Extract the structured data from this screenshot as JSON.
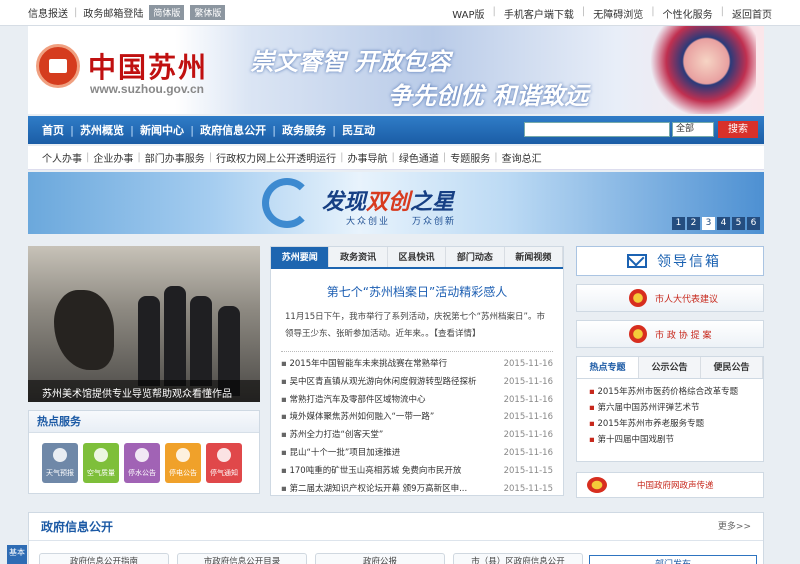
{
  "topbar": {
    "left": [
      "信息报送",
      "政务邮箱登陆"
    ],
    "lang": [
      "简体版",
      "繁体版"
    ],
    "right": [
      "WAP版",
      "手机客户端下载",
      "无障碍浏览",
      "个性化服务",
      "返回首页"
    ]
  },
  "header": {
    "site_name": "中国苏州",
    "url": "www.suzhou.gov.cn",
    "slogan_1": "崇文睿智 开放包容",
    "slogan_2": "争先创优 和谐致远"
  },
  "nav": {
    "items": [
      "首页",
      "苏州概览",
      "新闻中心",
      "政府信息公开",
      "政务服务",
      "民互动"
    ],
    "search_placeholder": "",
    "scope": "全部",
    "search_button": "搜索"
  },
  "subnav": [
    "个人办事",
    "企业办事",
    "部门办事服务",
    "行政权力网上公开透明运行",
    "办事导航",
    "绿色通道",
    "专题服务",
    "查询总汇"
  ],
  "banner": {
    "title_a": "发现",
    "title_b": "双创",
    "title_c": "之星",
    "subtitle": "大众创业　　万众创新",
    "pages": [
      "1",
      "2",
      "3",
      "4",
      "5",
      "6"
    ],
    "active_page": 3
  },
  "photo": {
    "caption": "苏州美术馆提供专业导览帮助观众看懂作品"
  },
  "hot_services": {
    "title": "热点服务",
    "items": [
      {
        "label": "天气预报",
        "color": "#6f88a8"
      },
      {
        "label": "空气质量",
        "color": "#7ebf3a"
      },
      {
        "label": "停水公告",
        "color": "#a163b5"
      },
      {
        "label": "停电公告",
        "color": "#f0a12a"
      },
      {
        "label": "停气通知",
        "color": "#e0484a"
      }
    ]
  },
  "news": {
    "tabs": [
      "苏州要闻",
      "政务资讯",
      "区县快讯",
      "部门动态",
      "新闻视频"
    ],
    "headline": "第七个“苏州档案日”活动精彩感人",
    "summary": "11月15日下午，我市举行了系列活动，庆祝第七个“苏州档案日”。市领导王少东、张昕参加活动。近年来。。【查看详情】",
    "items": [
      {
        "title": "2015年中国智能车未来挑战赛在常熟举行",
        "date": "2015-11-16"
      },
      {
        "title": "吴中区青直镇从观光游向休闲度假游转型路径探析",
        "date": "2015-11-16"
      },
      {
        "title": "常熟打造汽车及零部件区域物流中心",
        "date": "2015-11-16"
      },
      {
        "title": "境外媒体聚焦苏州如何融入“一带一路”",
        "date": "2015-11-16"
      },
      {
        "title": "苏州全力打造“创客天堂”",
        "date": "2015-11-16"
      },
      {
        "title": "昆山“十个一批”项目加速推进",
        "date": "2015-11-16"
      },
      {
        "title": "170吨重的矿世玉山亮相苏城 免费向市民开放",
        "date": "2015-11-15"
      },
      {
        "title": "第二届太湖知识产权论坛开幕 颁9万高新区申...",
        "date": "2015-11-15"
      }
    ]
  },
  "right": {
    "mailbox": "领导信箱",
    "entries": [
      "市人大代表建议",
      "市 政 协 提 案"
    ],
    "tabs": [
      "热点专题",
      "公示公告",
      "便民公告"
    ],
    "topics": [
      "2015年苏州市医药价格综合改革专题",
      "第六届中国苏州评弹艺术节",
      "2015年苏州市养老服务专题",
      "第十四届中国戏剧节"
    ],
    "gov_link": "中国政府网政声传递"
  },
  "bottom": {
    "title": "政府信息公开",
    "more": "更多>>",
    "subs": [
      "政府信息公开指南",
      "市政府信息公开目录",
      "政府公报",
      "市（县）区政府信息公开"
    ],
    "right_label": "部门发布"
  },
  "side_tab": "基本"
}
